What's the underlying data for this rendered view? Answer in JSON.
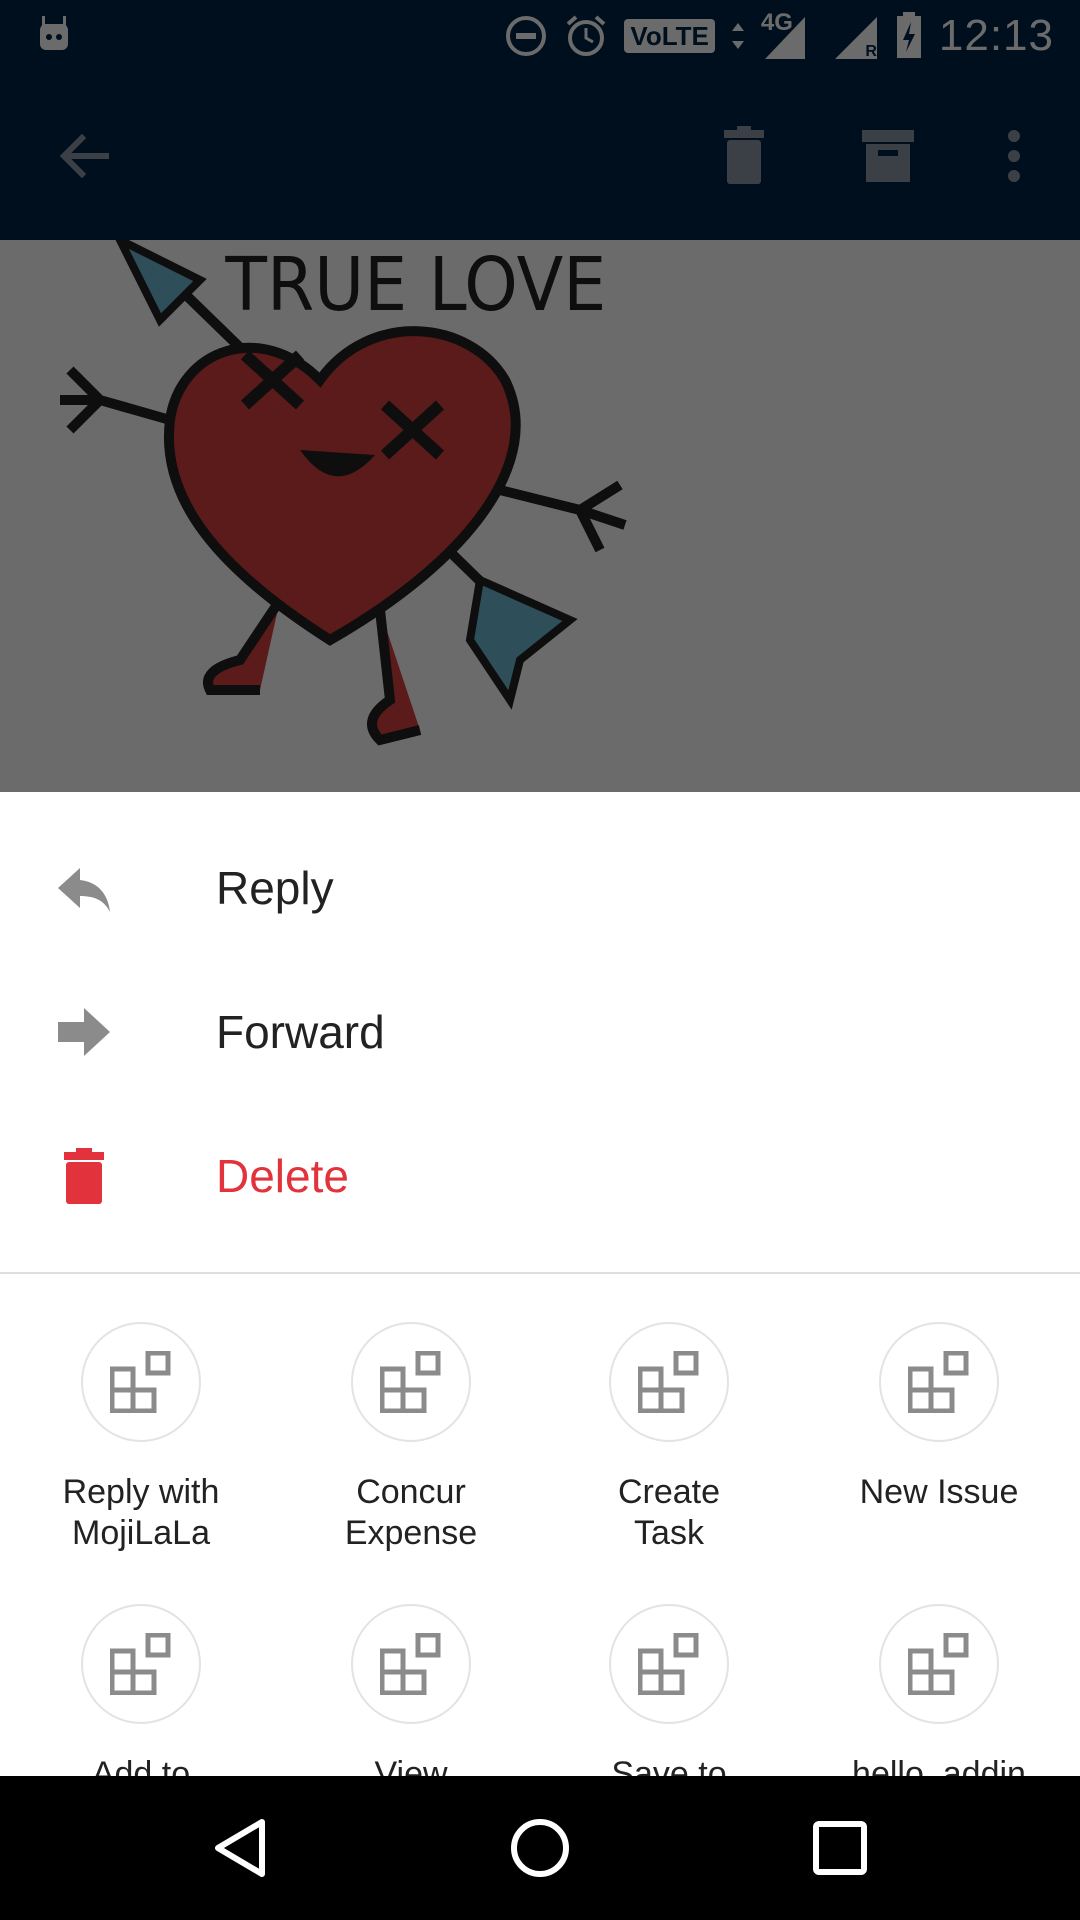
{
  "status_bar": {
    "time": "12:13",
    "volte": "VoLTE",
    "network": "4G",
    "roaming_1": "R",
    "roaming_2": "R"
  },
  "app_bar": {
    "back": "back-arrow-icon",
    "delete": "trash-icon",
    "archive": "archive-icon",
    "more": "more-vertical-icon"
  },
  "email": {
    "sticker_text": "TRUE LOVE"
  },
  "sheet": {
    "actions": [
      {
        "label": "Reply",
        "icon": "reply-icon"
      },
      {
        "label": "Forward",
        "icon": "forward-icon"
      },
      {
        "label": "Delete",
        "icon": "trash-icon",
        "color": "#e2323b"
      }
    ],
    "addins": [
      {
        "label": "Reply with\nMojiLaLa"
      },
      {
        "label": "Concur\nExpense"
      },
      {
        "label": "Create\nTask"
      },
      {
        "label": "New Issue"
      },
      {
        "label": "Add to"
      },
      {
        "label": "View"
      },
      {
        "label": "Save to"
      },
      {
        "label": "hello_addin"
      }
    ]
  },
  "colors": {
    "app_bar": "#012445",
    "delete": "#e2323b",
    "icon_gray": "#888888"
  }
}
